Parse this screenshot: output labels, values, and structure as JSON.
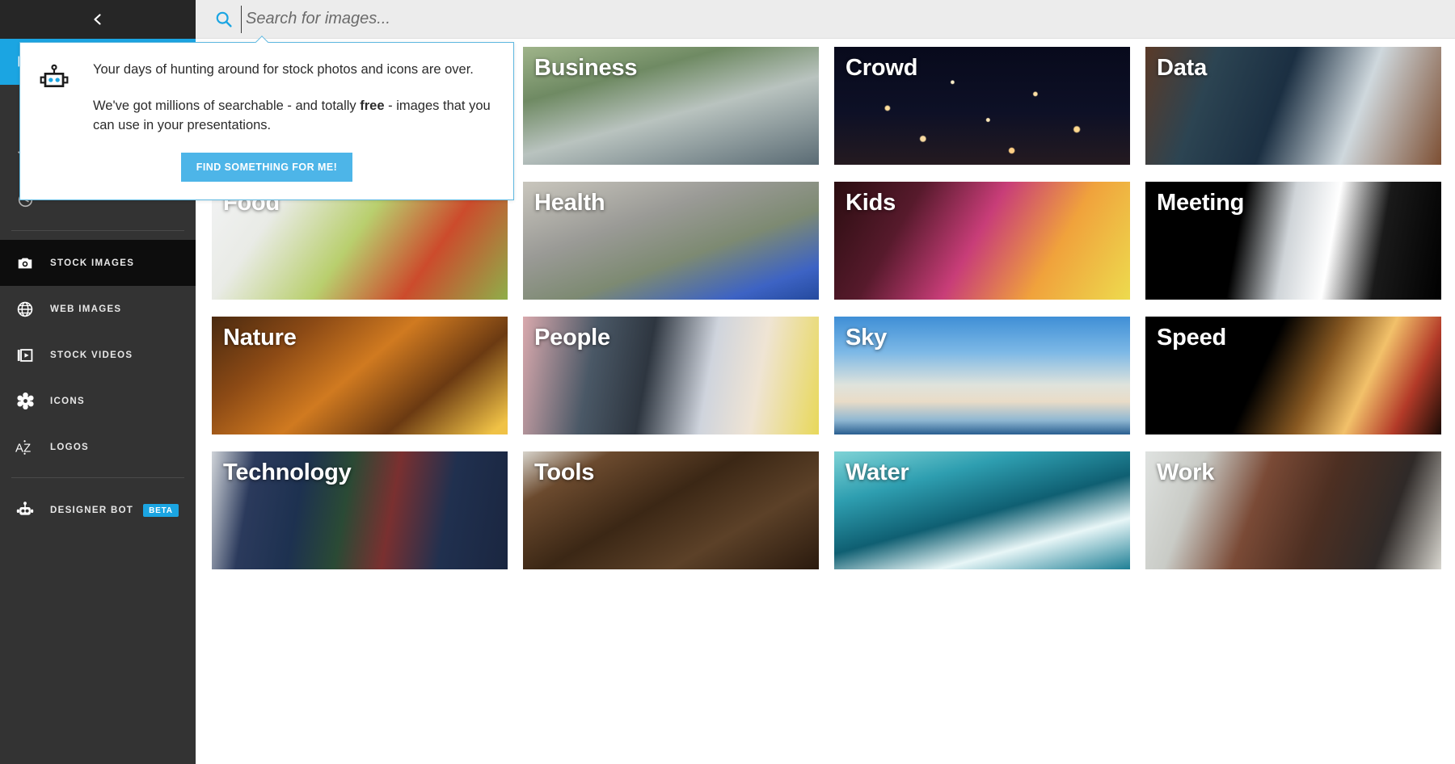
{
  "sidebar": {
    "collapse_icon": "chevron-left-icon",
    "top_items": [
      {
        "label": "",
        "icon": "slides-icon",
        "active": true
      },
      {
        "label": "",
        "icon": "person-icon",
        "active": false
      },
      {
        "label": "",
        "icon": "star-outline-icon",
        "active": false
      },
      {
        "label": "",
        "icon": "clock-icon",
        "active": false
      }
    ],
    "items": [
      {
        "label": "STOCK IMAGES",
        "icon": "camera-icon",
        "selected": true,
        "badge": ""
      },
      {
        "label": "WEB IMAGES",
        "icon": "globe-icon",
        "selected": false,
        "badge": ""
      },
      {
        "label": "STOCK VIDEOS",
        "icon": "video-icon",
        "selected": false,
        "badge": ""
      },
      {
        "label": "ICONS",
        "icon": "gear-flower-icon",
        "selected": false,
        "badge": ""
      },
      {
        "label": "LOGOS",
        "icon": "az-icon",
        "selected": false,
        "badge": ""
      }
    ],
    "bottom_items": [
      {
        "label": "DESIGNER BOT",
        "icon": "robot-icon",
        "selected": false,
        "badge": "BETA"
      }
    ]
  },
  "search": {
    "icon": "search-icon",
    "value": "",
    "placeholder": "Search for images..."
  },
  "popover": {
    "icon": "robot-icon",
    "line1": "Your days of hunting around for stock photos and icons are over.",
    "line2_a": "We've got millions of searchable - and totally ",
    "line2_free": "free",
    "line2_b": " - images that you can use in your presentations.",
    "button_label": "FIND SOMETHING FOR ME!"
  },
  "grid": {
    "tiles": [
      {
        "label": "Business",
        "art": "business",
        "row": 1,
        "col": 1
      },
      {
        "label": "Crowd",
        "art": "crowd",
        "row": 1,
        "col": 2
      },
      {
        "label": "Data",
        "art": "data",
        "row": 1,
        "col": 3
      },
      {
        "label": "Food",
        "art": "food",
        "row": 2,
        "col": 0
      },
      {
        "label": "Health",
        "art": "health",
        "row": 2,
        "col": 1
      },
      {
        "label": "Kids",
        "art": "kids",
        "row": 2,
        "col": 2
      },
      {
        "label": "Meeting",
        "art": "meeting",
        "row": 2,
        "col": 3
      },
      {
        "label": "Nature",
        "art": "nature",
        "row": 3,
        "col": 0
      },
      {
        "label": "People",
        "art": "people",
        "row": 3,
        "col": 1
      },
      {
        "label": "Sky",
        "art": "sky",
        "row": 3,
        "col": 2
      },
      {
        "label": "Speed",
        "art": "speed",
        "row": 3,
        "col": 3
      },
      {
        "label": "Technology",
        "art": "technology",
        "row": 4,
        "col": 0
      },
      {
        "label": "Tools",
        "art": "tools",
        "row": 4,
        "col": 1
      },
      {
        "label": "Water",
        "art": "water",
        "row": 4,
        "col": 2
      },
      {
        "label": "Work",
        "art": "work",
        "row": 4,
        "col": 3
      }
    ]
  },
  "colors": {
    "accent": "#1ba5e2",
    "sidebar_bg": "#333333",
    "sidebar_header_bg": "#262626",
    "selected_bg": "#0d0d0d",
    "topbar_bg": "#ececec",
    "popover_border": "#5eb8e0",
    "button_bg": "#4db5e8"
  }
}
